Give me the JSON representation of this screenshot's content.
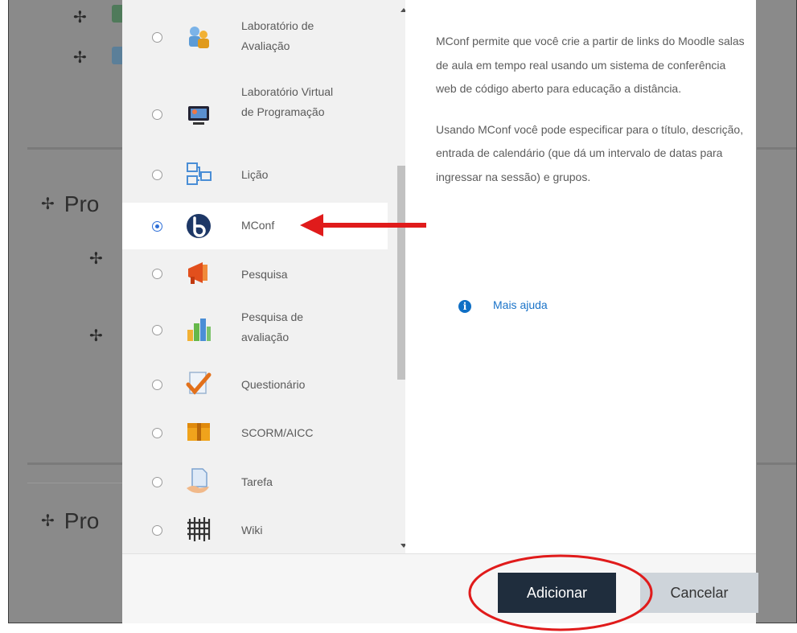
{
  "background": {
    "section_heading_1": "Pro",
    "section_heading_2": "Pro"
  },
  "activities": [
    {
      "label": "Laboratório de Avaliação",
      "icon": "people-lab-icon",
      "selected": false
    },
    {
      "label": "Laboratório Virtual de Programação",
      "icon": "programming-lab-icon",
      "selected": false
    },
    {
      "label": "Lição",
      "icon": "lesson-icon",
      "selected": false
    },
    {
      "label": "MConf",
      "icon": "mconf-icon",
      "selected": true
    },
    {
      "label": "Pesquisa",
      "icon": "megaphone-icon",
      "selected": false
    },
    {
      "label": "Pesquisa de avaliação",
      "icon": "bar-chart-icon",
      "selected": false
    },
    {
      "label": "Questionário",
      "icon": "quiz-check-icon",
      "selected": false
    },
    {
      "label": "SCORM/AICC",
      "icon": "package-icon",
      "selected": false
    },
    {
      "label": "Tarefa",
      "icon": "assignment-icon",
      "selected": false
    },
    {
      "label": "Wiki",
      "icon": "wiki-icon",
      "selected": false
    }
  ],
  "description": {
    "paragraph_1": "MConf permite que você crie a partir de links do Moodle salas de aula em tempo real usando um sistema de conferência web de código aberto para educação a distância.",
    "paragraph_2": "Usando MConf você pode especificar para o título, descrição, entrada de calendário (que dá um intervalo de datas para ingressar na sessão) e grupos.",
    "help_link": "Mais ajuda"
  },
  "footer": {
    "add_label": "Adicionar",
    "cancel_label": "Cancelar"
  },
  "colors": {
    "primary_button": "#1f2d3d",
    "annotation_red": "#e01b1b",
    "link": "#1a73c8"
  }
}
